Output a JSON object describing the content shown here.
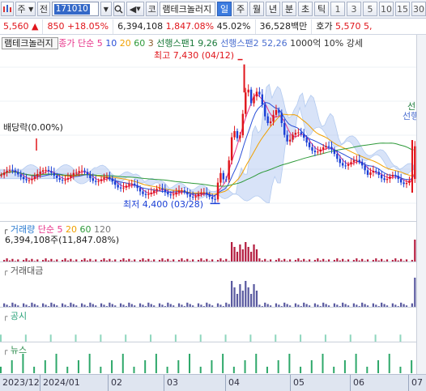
{
  "toolbar": {
    "market_btn": "주",
    "all_btn": "전",
    "code_value": "171010",
    "stock_name": "램테크놀러지",
    "periods": [
      "일",
      "주",
      "월",
      "년",
      "분",
      "초",
      "틱"
    ],
    "active_period": "일",
    "intervals": [
      "1",
      "3",
      "5",
      "10",
      "15",
      "30"
    ],
    "code_prefix": "코"
  },
  "quote": {
    "price": "5,560",
    "direction": "▲",
    "change": "850",
    "change_pct": "+18.05%",
    "volume": "6,394,108",
    "volume_ratio": "1,847.08%",
    "turnover_pct": "45.02%",
    "amount": "36,528백만",
    "ask_label": "호가",
    "ask_price": "5,570",
    "next_val": "5,"
  },
  "price_panel": {
    "name": "램테크놀러지",
    "ma_label": "종가 단순",
    "ma_periods": [
      "5",
      "10",
      "20",
      "60",
      "3"
    ],
    "ichimoku1": "선행스팬1 9,26",
    "ichimoku2": "선행스팬2 52,26",
    "unit_info": "1000억 10% 강세",
    "high_label": "최고 7,430 (04/12)",
    "low_label": "최저 4,400 (03/28)",
    "dividend_label": "배당락(0.00%)",
    "side_label1": "선",
    "side_label2": "선행"
  },
  "volume_panel": {
    "title": "거래량",
    "ma_label": "단순",
    "ma_periods": [
      "5",
      "20",
      "60",
      "120"
    ],
    "value": "6,394,108주(11,847.08%)"
  },
  "amount_panel": {
    "title": "거래대금"
  },
  "disclosure_panel": {
    "title": "공시"
  },
  "news_panel": {
    "title": "뉴스"
  },
  "xaxis": {
    "labels": [
      "2023/12",
      "2024/01",
      "02",
      "03",
      "04",
      "05",
      "06",
      "07"
    ]
  },
  "colors": {
    "up": "#e0151b",
    "down": "#1a3fd6",
    "ma5": "#e8348a",
    "ma10": "#2a4fd8",
    "ma20": "#f0a000",
    "ma60": "#2e9a3a",
    "cloud": "#5a8de0"
  },
  "chart_data": {
    "type": "candlestick",
    "title": "램테크놀러지",
    "high": {
      "value": 7430,
      "date": "04/12"
    },
    "low": {
      "value": 4400,
      "date": "03/28"
    },
    "last_close": 5560,
    "volume_last": 6394108
  }
}
